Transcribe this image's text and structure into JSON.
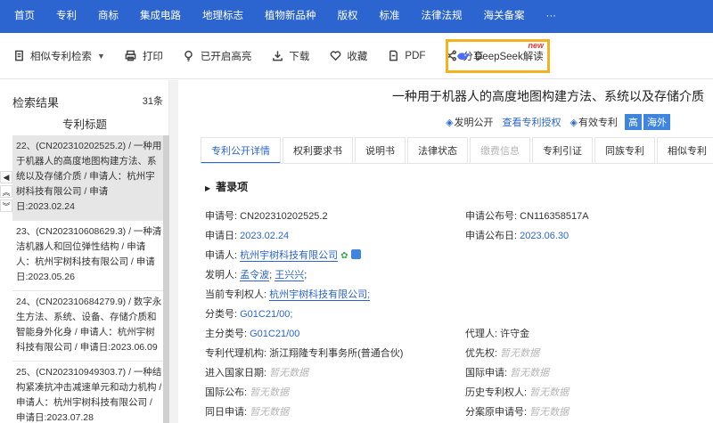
{
  "nav": [
    "首页",
    "专利",
    "商标",
    "集成电路",
    "地理标志",
    "植物新品种",
    "版权",
    "标准",
    "法律法规",
    "海关备案",
    "···"
  ],
  "toolbar": {
    "similar": "相似专利检索",
    "print": "打印",
    "highlight": "已开启高亮",
    "download": "下载",
    "favorite": "收藏",
    "pdf": "PDF",
    "share": "分享",
    "deepseek": "DeepSeek解读",
    "new_tag": "new"
  },
  "left": {
    "title": "检索结果",
    "count": "31条",
    "subtitle": "专利标题",
    "items": [
      "22、(CN202310202525.2) / 一种用于机器人的高度地图构建方法、系统以及存储介质 / 申请人：杭州宇树科技有限公司 / 申请日:2023.02.24",
      "23、(CN202310608629.3) / 一种清洁机器人和回位弹性结构 / 申请人：杭州宇树科技有限公司 / 申请日:2023.05.26",
      "24、(CN202310684279.9) / 数字永生方法、系统、设备、存储介质和智能身外化身 / 申请人：杭州宇树科技有限公司 / 申请日:2023.06.09",
      "25、(CN202310949303.7) / 一种结构紧凑抗冲击减速单元和动力机构 / 申请人：杭州宇树科技有限公司 / 申请日:2023.07.28"
    ]
  },
  "right": {
    "title": "一种用于机器人的高度地图构建方法、系统以及存储介质",
    "status": {
      "publish": "发明公开",
      "view_grant": "查看专利授权",
      "valid": "有效专利",
      "badge_high": "高",
      "badge_overseas": "海外"
    },
    "tabs": [
      "专利公开详情",
      "权利要求书",
      "说明书",
      "法律状态",
      "缴费信息",
      "专利引证",
      "同族专利",
      "相似专利",
      "复审"
    ],
    "section": "著录项",
    "fields": {
      "app_no_label": "申请号:",
      "app_no": "CN202310202525.2",
      "pub_no_label": "申请公布号:",
      "pub_no": "CN116358517A",
      "app_date_label": "申请日:",
      "app_date": "2023.02.24",
      "pub_date_label": "申请公布日:",
      "pub_date": "2023.06.30",
      "applicant_label": "申请人:",
      "applicant": "杭州宇树科技有限公司",
      "inventor_label": "发明人:",
      "inventor1": "孟令波",
      "inventor2": "王兴兴",
      "owner_label": "当前专利权人:",
      "owner": "杭州宇树科技有限公司;",
      "class_label": "分类号:",
      "class": "G01C21/00;",
      "main_class_label": "主分类号:",
      "main_class": "G01C21/00",
      "agent_label": "代理人:",
      "agent": "许守金",
      "agency_label": "专利代理机构:",
      "agency": "浙江翔隆专利事务所(普通合伙)",
      "priority_label": "优先权:",
      "priority": "暂无数据",
      "enter_date_label": "进入国家日期:",
      "enter_date": "暂无数据",
      "intl_app_label": "国际申请:",
      "intl_app": "暂无数据",
      "intl_pub_label": "国际公布:",
      "intl_pub": "暂无数据",
      "history_owner_label": "历史专利权人:",
      "history_owner": "暂无数据",
      "same_day_label": "同日申请:",
      "same_day": "暂无数据",
      "div_label": "分案原申请号:",
      "div": "暂无数据"
    }
  }
}
